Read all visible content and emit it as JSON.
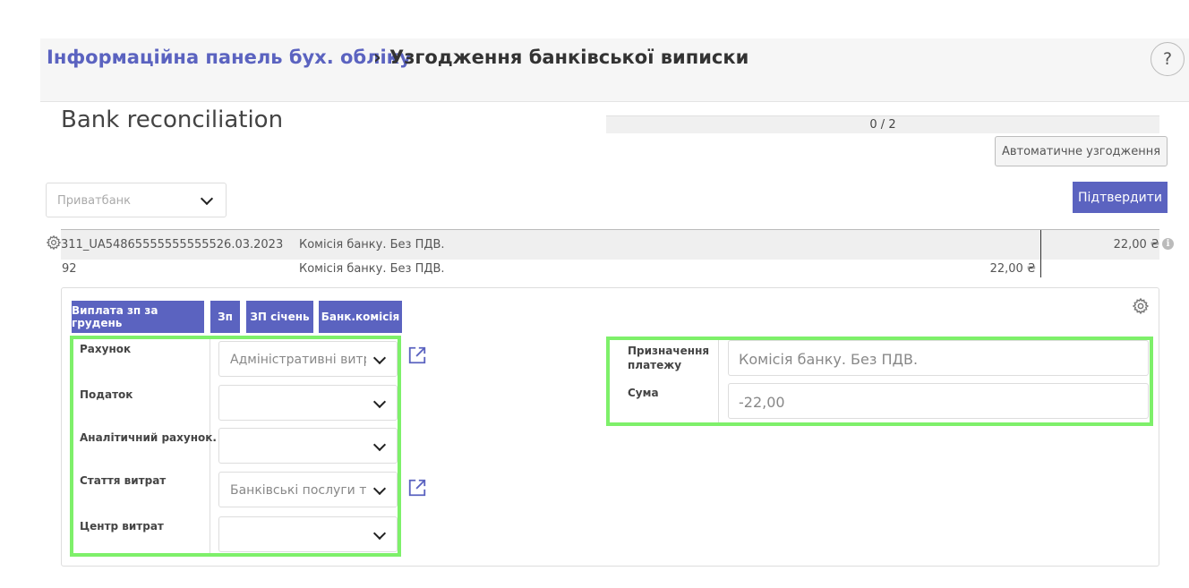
{
  "breadcrumb": {
    "parent": "Інформаційна панель бух. обліку",
    "separator": "›",
    "current": "Узгодження банківської виписки"
  },
  "help_label": "?",
  "page_title": "Bank reconciliation",
  "progress": {
    "text": "0 / 2",
    "done": 0,
    "total": 2
  },
  "buttons": {
    "auto_reconcile": "Автоматичне узгодження",
    "confirm": "Підтвердити"
  },
  "journal_select": {
    "value": "Приватбанк"
  },
  "statement_line": {
    "reference": "311_UA54865555555555526.03.2023",
    "label": "Комісія банку. Без ПДВ.",
    "amount": "22,00 ₴"
  },
  "counterpart_line": {
    "reference": "92",
    "label": "Комісія банку. Без ПДВ.",
    "amount": "22,00 ₴"
  },
  "reconcile_models": [
    "Виплата зп за грудень",
    "Зп",
    "ЗП січень",
    "Банк.комісія"
  ],
  "form_left": {
    "account_label": "Рахунок",
    "account_value": "Адміністративні витрати",
    "tax_label": "Податок",
    "tax_value": "",
    "analytic_label": "Аналітичний рахунок.",
    "analytic_value": "",
    "expense_item_label": "Стаття витрат",
    "expense_item_value": "Банківські послуги та збори",
    "cost_center_label": "Центр витрат",
    "cost_center_value": ""
  },
  "form_right": {
    "purpose_label": "Призначення платежу",
    "purpose_value": "Комісія банку. Без ПДВ.",
    "amount_label": "Сума",
    "amount_value": "-22,00"
  },
  "colors": {
    "accent": "#5b63c0",
    "highlight": "#7ef06a"
  }
}
